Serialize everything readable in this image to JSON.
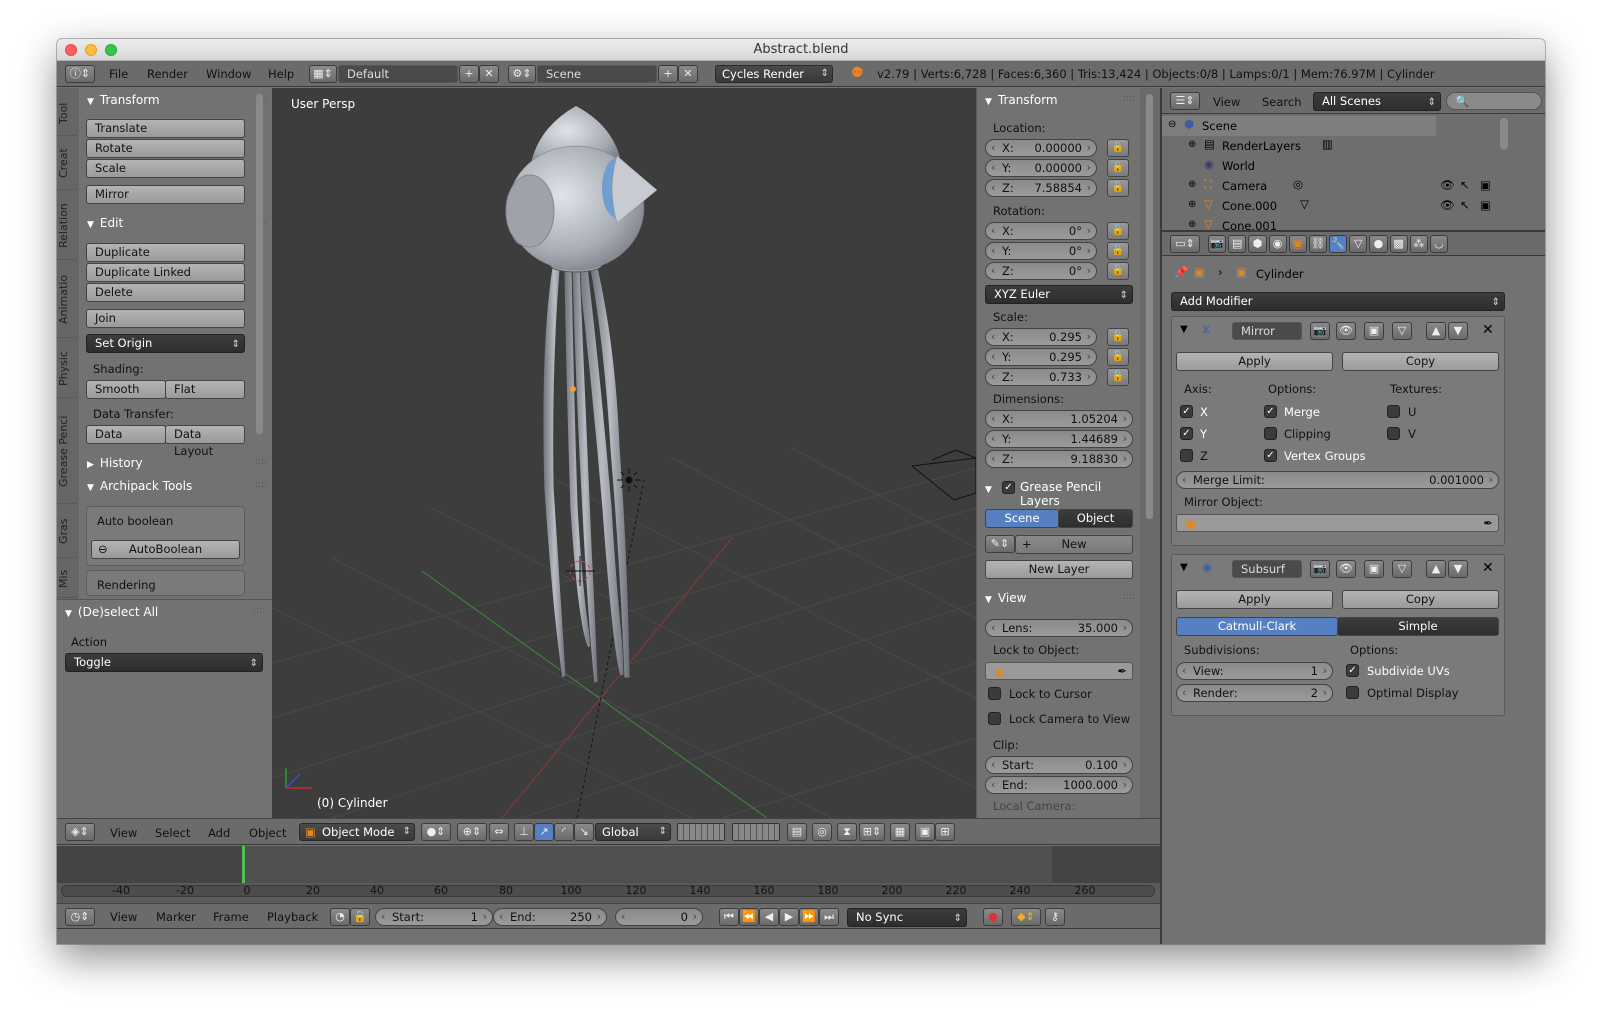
{
  "window": {
    "title": "Abstract.blend"
  },
  "topbar": {
    "menus": [
      "File",
      "Render",
      "Window",
      "Help"
    ],
    "layout": "Default",
    "scene": "Scene",
    "engine": "Cycles Render",
    "stats": "v2.79 | Verts:6,728 | Faces:6,360 | Tris:13,424 | Objects:0/8 | Lamps:0/1 | Mem:76.97M | Cylinder"
  },
  "tool_tabs": [
    "Tool",
    "Creat",
    "Relation",
    "Animatio",
    "Physic",
    "Grease Penci",
    "Gras",
    "Mis"
  ],
  "toolshelf": {
    "transform": {
      "title": "Transform",
      "buttons": [
        "Translate",
        "Rotate",
        "Scale"
      ],
      "mirror": "Mirror"
    },
    "edit": {
      "title": "Edit",
      "buttons": [
        "Duplicate",
        "Duplicate Linked",
        "Delete"
      ],
      "join": "Join",
      "set_origin": "Set Origin",
      "shading_label": "Shading:",
      "smooth": "Smooth",
      "flat": "Flat",
      "data_transfer_label": "Data Transfer:",
      "data": "Data",
      "data_layout": "Data Layout"
    },
    "history": "History",
    "archipack": {
      "title": "Archipack Tools",
      "auto_boolean": "Auto boolean",
      "autoboolean_btn": "AutoBoolean",
      "rendering": "Rendering"
    },
    "operator": {
      "title": "(De)select All",
      "action_label": "Action",
      "action": "Toggle"
    }
  },
  "viewport": {
    "label": "User Persp",
    "object_label": "(0) Cylinder"
  },
  "properties_n": {
    "transform": {
      "title": "Transform",
      "location_label": "Location:",
      "location": [
        {
          "k": "X:",
          "v": "0.00000"
        },
        {
          "k": "Y:",
          "v": "0.00000"
        },
        {
          "k": "Z:",
          "v": "7.58854"
        }
      ],
      "rotation_label": "Rotation:",
      "rotation": [
        {
          "k": "X:",
          "v": "0°"
        },
        {
          "k": "Y:",
          "v": "0°"
        },
        {
          "k": "Z:",
          "v": "0°"
        }
      ],
      "rotation_mode": "XYZ Euler",
      "scale_label": "Scale:",
      "scale": [
        {
          "k": "X:",
          "v": "0.295"
        },
        {
          "k": "Y:",
          "v": "0.295"
        },
        {
          "k": "Z:",
          "v": "0.733"
        }
      ],
      "dimensions_label": "Dimensions:",
      "dimensions": [
        {
          "k": "X:",
          "v": "1.05204"
        },
        {
          "k": "Y:",
          "v": "1.44689"
        },
        {
          "k": "Z:",
          "v": "9.18830"
        }
      ]
    },
    "grease": {
      "title": "Grease Pencil Layers",
      "scene": "Scene",
      "object": "Object",
      "new": "New",
      "new_layer": "New Layer"
    },
    "view": {
      "title": "View",
      "lens_k": "Lens:",
      "lens_v": "35.000",
      "lock_object_label": "Lock to Object:",
      "lock_cursor": "Lock to Cursor",
      "lock_camera": "Lock Camera to View",
      "clip_label": "Clip:",
      "start_k": "Start:",
      "start_v": "0.100",
      "end_k": "End:",
      "end_v": "1000.000",
      "local_camera": "Local Camera:"
    }
  },
  "outliner": {
    "view": "View",
    "search": "Search",
    "filter": "All Scenes",
    "items": [
      "Scene",
      "RenderLayers",
      "World",
      "Camera",
      "Cone.000",
      "Cone.001"
    ]
  },
  "properties": {
    "object": "Cylinder",
    "add_modifier": "Add Modifier",
    "mirror": {
      "name": "Mirror",
      "apply": "Apply",
      "copy": "Copy",
      "axis_label": "Axis:",
      "options_label": "Options:",
      "textures_label": "Textures:",
      "x": "X",
      "y": "Y",
      "z": "Z",
      "merge": "Merge",
      "clipping": "Clipping",
      "vertex_groups": "Vertex Groups",
      "u": "U",
      "v": "V",
      "merge_limit_k": "Merge Limit:",
      "merge_limit_v": "0.001000",
      "mirror_object_label": "Mirror Object:"
    },
    "subsurf": {
      "name": "Subsurf",
      "apply": "Apply",
      "copy": "Copy",
      "catmull": "Catmull-Clark",
      "simple": "Simple",
      "subdivisions_label": "Subdivisions:",
      "options_label": "Options:",
      "view_k": "View:",
      "view_v": "1",
      "render_k": "Render:",
      "render_v": "2",
      "subdivide_uvs": "Subdivide UVs",
      "optimal_display": "Optimal Display"
    }
  },
  "view3d_header": {
    "menus": [
      "View",
      "Select",
      "Add",
      "Object"
    ],
    "mode": "Object Mode",
    "orientation": "Global"
  },
  "timeline": {
    "ticks": [
      "-40",
      "-20",
      "0",
      "20",
      "40",
      "60",
      "80",
      "100",
      "120",
      "140",
      "160",
      "180",
      "200",
      "220",
      "240",
      "260"
    ],
    "menus": [
      "View",
      "Marker",
      "Frame",
      "Playback"
    ],
    "start_k": "Start:",
    "start_v": "1",
    "end_k": "End:",
    "end_v": "250",
    "current": "0",
    "sync": "No Sync"
  },
  "colors": {
    "accent": "#5680c2",
    "viewport_bg": "#3d3d3d",
    "panel_bg": "#727272"
  }
}
